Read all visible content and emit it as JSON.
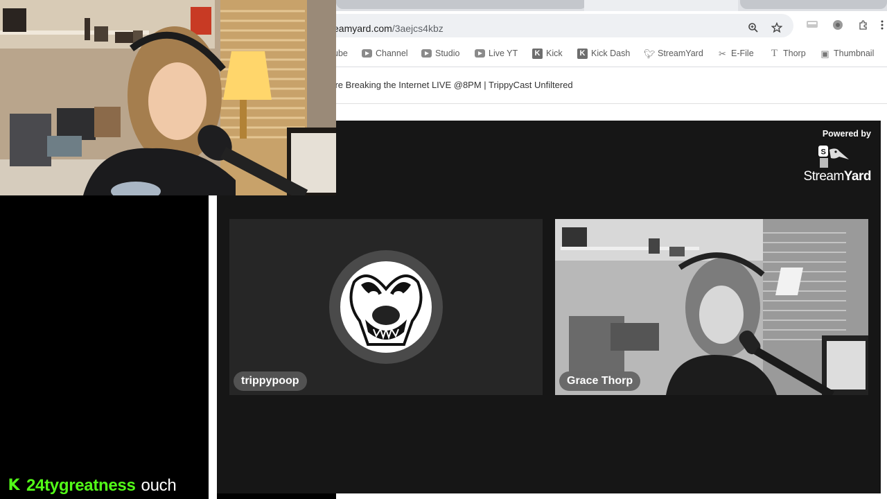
{
  "browser": {
    "url_host": "eamyard.com",
    "url_path": "/3aejcs4kbz",
    "bookmarks": [
      {
        "label": "ube",
        "icon": "youtube-icon"
      },
      {
        "label": "Channel",
        "icon": "youtube-icon"
      },
      {
        "label": "Studio",
        "icon": "youtube-icon"
      },
      {
        "label": "Live YT",
        "icon": "youtube-icon"
      },
      {
        "label": "Kick",
        "icon": "kick-icon"
      },
      {
        "label": "Kick Dash",
        "icon": "kick-icon"
      },
      {
        "label": "StreamYard",
        "icon": "streamyard-icon"
      },
      {
        "label": "E-File",
        "icon": "efile-icon"
      },
      {
        "label": "Thorp",
        "icon": "text-t-icon"
      },
      {
        "label": "Thumbnail",
        "icon": "thumbnail-icon"
      }
    ],
    "page_title": "'re Breaking the Internet LIVE @8PM | TrippyCast Unfiltered"
  },
  "stage": {
    "powered_by": "Powered by",
    "brand_stream": "Stream",
    "brand_yard": "Yard",
    "participants": [
      {
        "name": "trippypoop",
        "type": "avatar"
      },
      {
        "name": "Grace Thorp",
        "type": "video"
      }
    ]
  },
  "chat": {
    "platform_icon": "kick-icon",
    "username": "24tygreatness",
    "message": "ouch",
    "username_color": "#53fc18"
  },
  "colors": {
    "stage_bg": "#161616",
    "tile_bg": "#262626",
    "kick_green": "#53fc18"
  }
}
